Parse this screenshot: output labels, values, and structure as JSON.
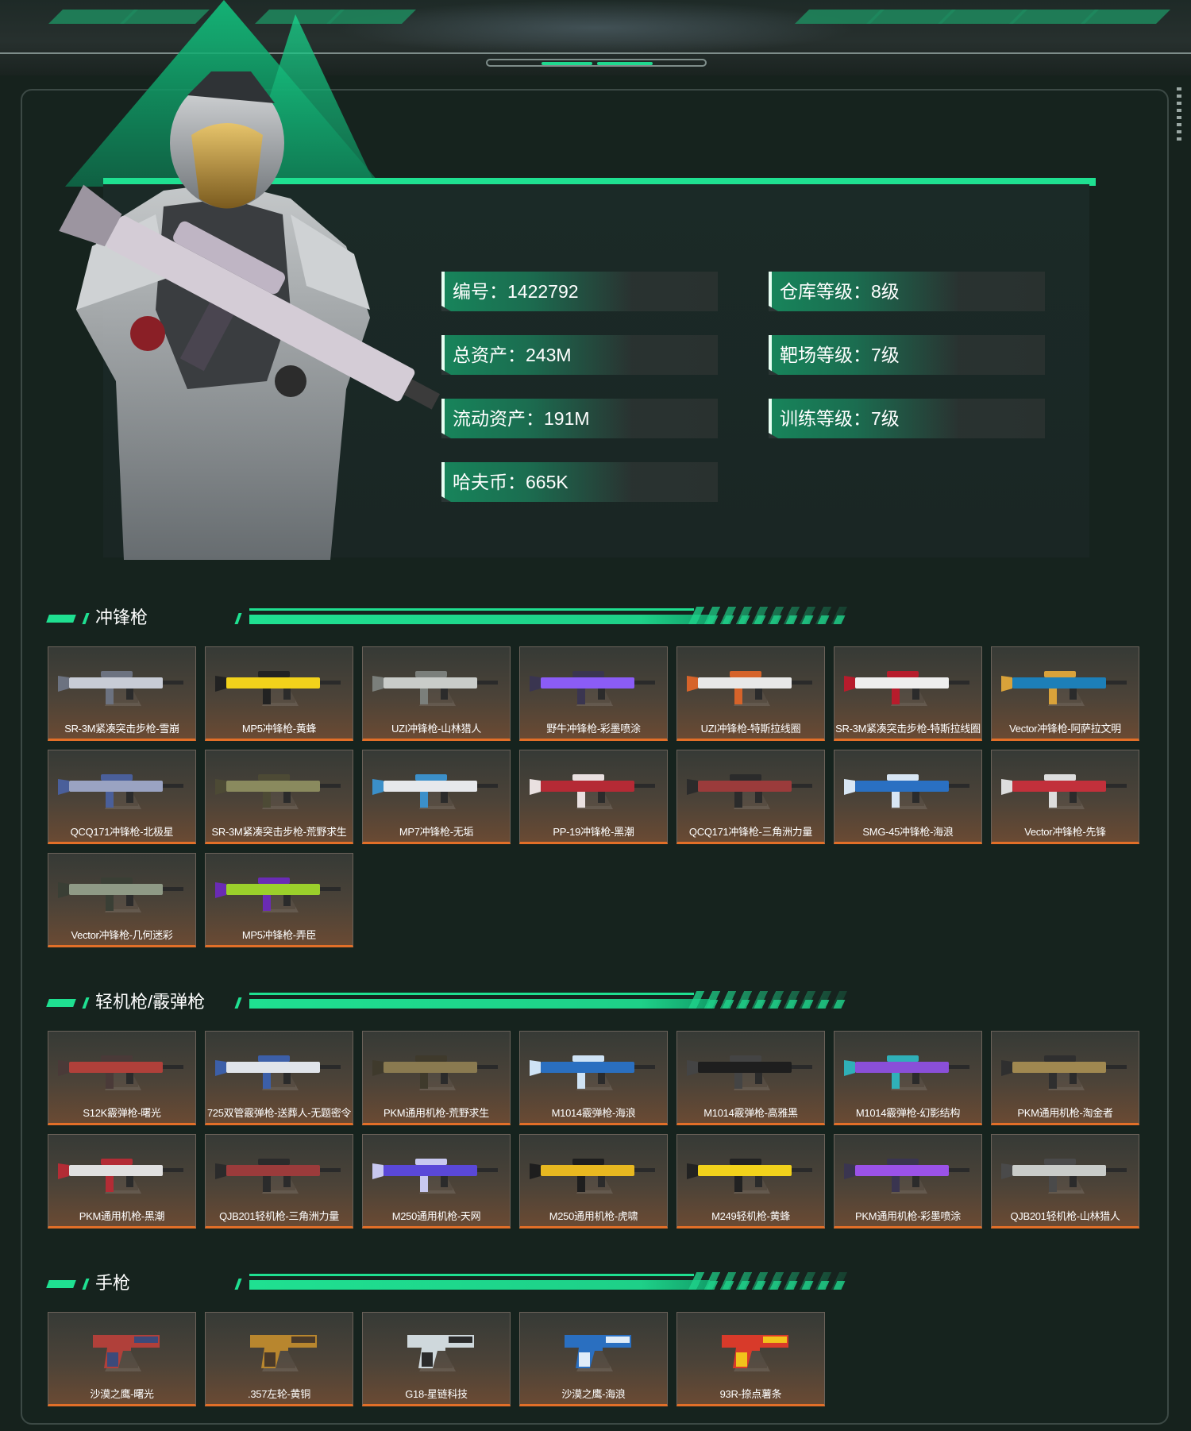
{
  "profile": {
    "stats_left": [
      {
        "label": "编号：1422792"
      },
      {
        "label": "总资产：243M"
      },
      {
        "label": "流动资产：191M"
      },
      {
        "label": "哈夫币：665K"
      }
    ],
    "stats_right": [
      {
        "label": "仓库等级：8级"
      },
      {
        "label": "靶场等级：7级"
      },
      {
        "label": "训练等级：7级"
      }
    ]
  },
  "colors": {
    "accent": "#1fe091",
    "card_border_bottom": "#e26f28",
    "background": "#16221d"
  },
  "sections": [
    {
      "title": "冲锋枪",
      "items": [
        {
          "name": "SR-3M紧凑突击步枪-雪崩",
          "colors": [
            "#c8ccd6",
            "#6c7280"
          ]
        },
        {
          "name": "MP5冲锋枪-黄蜂",
          "colors": [
            "#f2d21b",
            "#222222"
          ]
        },
        {
          "name": "UZI冲锋枪-山林猎人",
          "colors": [
            "#c9ccc9",
            "#7b7f7b"
          ]
        },
        {
          "name": "野牛冲锋枪-彩墨喷涂",
          "colors": [
            "#8b5cf6",
            "#3a3550"
          ]
        },
        {
          "name": "UZI冲锋枪-特斯拉线圈",
          "colors": [
            "#e8e8e8",
            "#d6632a"
          ]
        },
        {
          "name": "SR-3M紧凑突击步枪-特斯拉线圈",
          "colors": [
            "#eeeeee",
            "#b71c2c"
          ]
        },
        {
          "name": "Vector冲锋枪-阿萨拉文明",
          "colors": [
            "#1d7fb8",
            "#d9a23a"
          ]
        },
        {
          "name": "QCQ171冲锋枪-北极星",
          "colors": [
            "#9aa3c2",
            "#4a5f9a"
          ]
        },
        {
          "name": "SR-3M紧凑突击步枪-荒野求生",
          "colors": [
            "#8a8a5e",
            "#4d4a35"
          ]
        },
        {
          "name": "MP7冲锋枪-无垢",
          "colors": [
            "#e6e8ec",
            "#3b8fc9"
          ]
        },
        {
          "name": "PP-19冲锋枪-黑潮",
          "colors": [
            "#b52a35",
            "#e9e0e0"
          ]
        },
        {
          "name": "QCQ171冲锋枪-三角洲力量",
          "colors": [
            "#9b3b3b",
            "#2b2b2b"
          ]
        },
        {
          "name": "SMG-45冲锋枪-海浪",
          "colors": [
            "#2a70c2",
            "#d8e6f4"
          ]
        },
        {
          "name": "Vector冲锋枪-先锋",
          "colors": [
            "#c2303b",
            "#dddddd"
          ]
        },
        {
          "name": "Vector冲锋枪-几何迷彩",
          "colors": [
            "#8f9a86",
            "#3a3f35"
          ]
        },
        {
          "name": "MP5冲锋枪-弄臣",
          "colors": [
            "#9bd02b",
            "#6a2bb5"
          ]
        }
      ]
    },
    {
      "title": "轻机枪/霰弹枪",
      "items": [
        {
          "name": "S12K霰弹枪-曙光",
          "colors": [
            "#b0403a",
            "#4a3a38"
          ]
        },
        {
          "name": "725双管霰弹枪-送葬人-无题密令",
          "colors": [
            "#e0e4ea",
            "#3c5fa8"
          ]
        },
        {
          "name": "PKM通用机枪-荒野求生",
          "colors": [
            "#8a7a50",
            "#3f3a2c"
          ]
        },
        {
          "name": "M1014霰弹枪-海浪",
          "colors": [
            "#2a6fc0",
            "#cfe3f5"
          ]
        },
        {
          "name": "M1014霰弹枪-高雅黑",
          "colors": [
            "#1e1e1e",
            "#444444"
          ]
        },
        {
          "name": "M1014霰弹枪-幻影结构",
          "colors": [
            "#8a4fd8",
            "#2fb0b8"
          ]
        },
        {
          "name": "PKM通用机枪-淘金者",
          "colors": [
            "#a08850",
            "#2f2f2f"
          ]
        },
        {
          "name": "PKM通用机枪-黑潮",
          "colors": [
            "#e0e0e0",
            "#b32c35"
          ]
        },
        {
          "name": "QJB201轻机枪-三角洲力量",
          "colors": [
            "#9b3b3b",
            "#2b2b2b"
          ]
        },
        {
          "name": "M250通用机枪-天网",
          "colors": [
            "#5a48d8",
            "#c8c8f0"
          ]
        },
        {
          "name": "M250通用机枪-虎啸",
          "colors": [
            "#e8b820",
            "#1e1e1e"
          ]
        },
        {
          "name": "M249轻机枪-黄蜂",
          "colors": [
            "#f2d21b",
            "#222222"
          ]
        },
        {
          "name": "PKM通用机枪-彩墨喷涂",
          "colors": [
            "#9b52e8",
            "#3a3550"
          ]
        },
        {
          "name": "QJB201轻机枪-山林猎人",
          "colors": [
            "#c9ccc9",
            "#4a4a4a"
          ]
        }
      ]
    },
    {
      "title": "手枪",
      "items": [
        {
          "name": "沙漠之鹰-曙光",
          "colors": [
            "#b0403a",
            "#3c4a7a"
          ]
        },
        {
          "name": ".357左轮-黄铜",
          "colors": [
            "#b8862e",
            "#4a3a2a"
          ]
        },
        {
          "name": "G18-星链科技",
          "colors": [
            "#cfd8dc",
            "#2b2b2b"
          ]
        },
        {
          "name": "沙漠之鹰-海浪",
          "colors": [
            "#2a6fc0",
            "#e0ecf8"
          ]
        },
        {
          "name": "93R-捺点薯条",
          "colors": [
            "#d83a2a",
            "#f2c21b"
          ]
        }
      ]
    }
  ]
}
